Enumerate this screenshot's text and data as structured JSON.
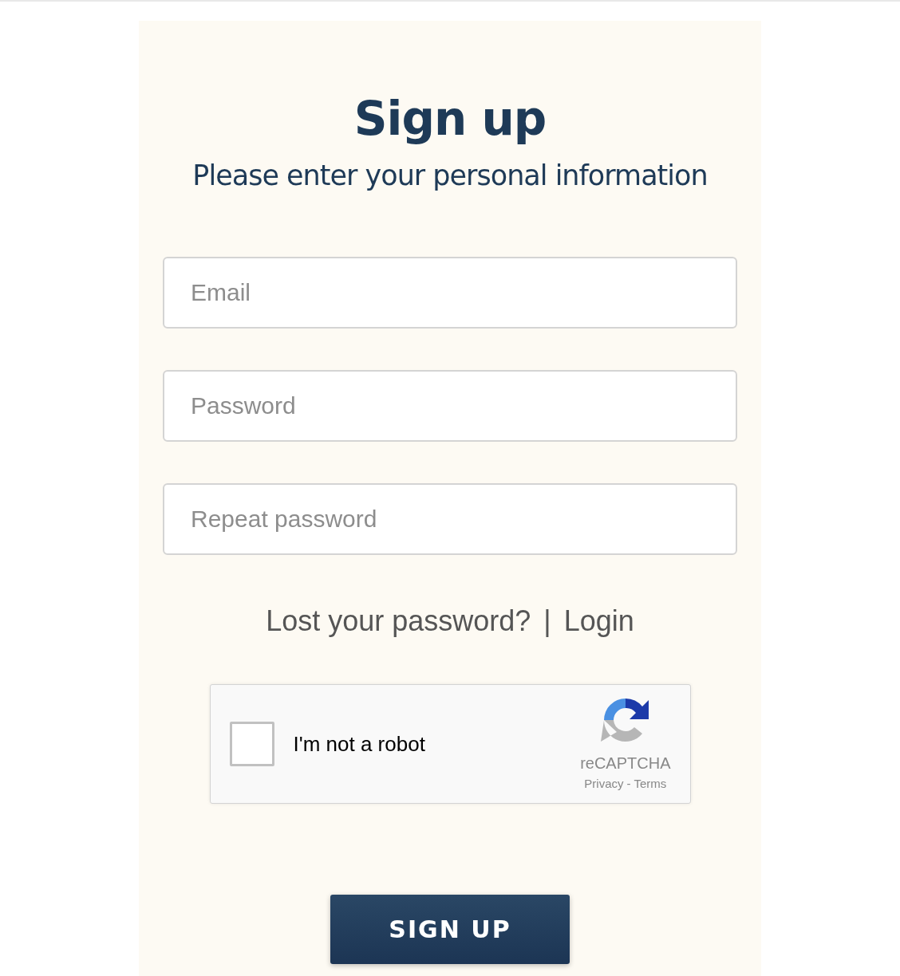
{
  "title": "Sign up",
  "subtitle": "Please enter your personal information",
  "fields": [
    {
      "placeholder": "Email"
    },
    {
      "placeholder": "Password"
    },
    {
      "placeholder": "Repeat password"
    }
  ],
  "links": [
    "Lost your password?",
    "Login"
  ],
  "link_separator": "|",
  "captcha": {
    "label": "I'm not a robot",
    "checked": false,
    "brand": "reCAPTCHA",
    "privacy": "Privacy",
    "dash": "-",
    "terms": "Terms"
  },
  "submit": "SIGN UP"
}
